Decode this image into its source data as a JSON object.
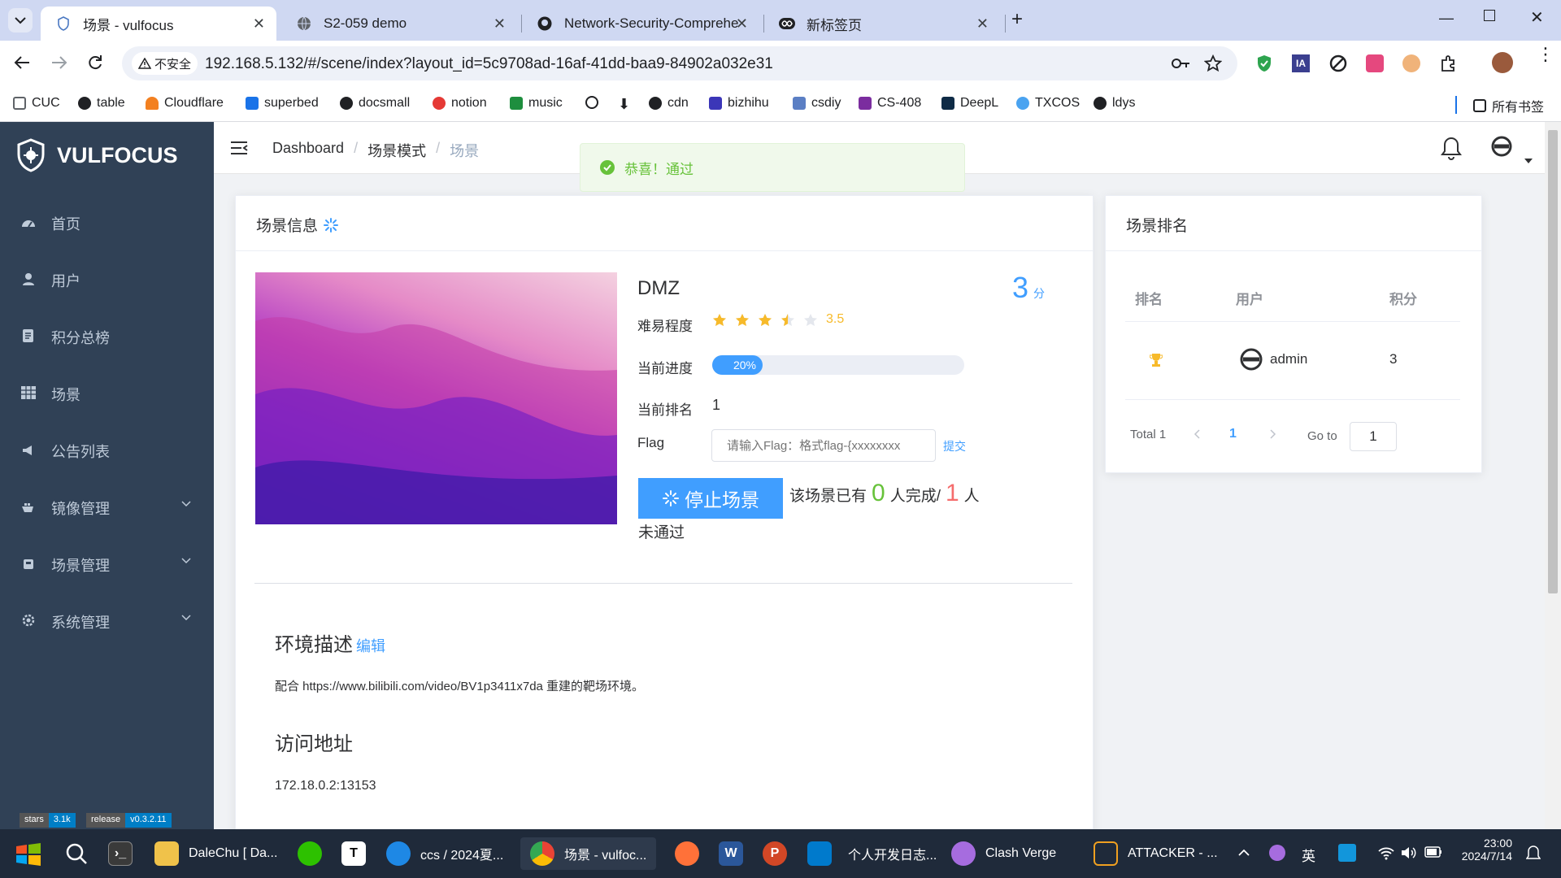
{
  "browser": {
    "tabs": [
      {
        "title": "场景 - vulfocus",
        "active": true
      },
      {
        "title": "S2-059 demo",
        "active": false
      },
      {
        "title": "Network-Security-Comprehe",
        "active": false
      },
      {
        "title": "新标签页",
        "active": false
      }
    ],
    "security_label": "不安全",
    "url": "192.168.5.132/#/scene/index?layout_id=5c9708ad-16af-41dd-baa9-84902a032e31",
    "bookmarks": [
      "CUC",
      "table",
      "Cloudflare",
      "superbed",
      "docsmall",
      "notion",
      "music",
      "cdn",
      "bizhihu",
      "csdiy",
      "CS-408",
      "DeepL",
      "TXCOS",
      "ldys"
    ],
    "all_bookmarks": "所有书签",
    "ext_ia": "IA"
  },
  "sidebar": {
    "logo": "VULFOCUS",
    "items": [
      {
        "label": "首页",
        "icon": "dashboard-icon"
      },
      {
        "label": "用户",
        "icon": "user-icon"
      },
      {
        "label": "积分总榜",
        "icon": "leaderboard-icon"
      },
      {
        "label": "场景",
        "icon": "table-icon"
      },
      {
        "label": "公告列表",
        "icon": "megaphone-icon"
      },
      {
        "label": "镜像管理",
        "icon": "image-icon"
      },
      {
        "label": "场景管理",
        "icon": "scene-icon"
      },
      {
        "label": "系统管理",
        "icon": "settings-icon"
      }
    ],
    "badges": {
      "stars_label": "stars",
      "stars_value": "3.1k",
      "release_label": "release",
      "release_value": "v0.3.2.11"
    }
  },
  "breadcrumb": [
    "Dashboard",
    "场景模式",
    "场景"
  ],
  "toast": "恭喜！通过",
  "scene": {
    "card_title": "场景信息",
    "name": "DMZ",
    "score": "3",
    "score_unit": "分",
    "difficulty_label": "难易程度",
    "difficulty_value": "3.5",
    "rating": 3.5,
    "progress_label": "当前进度",
    "progress_text": "20%",
    "progress": 0.2,
    "rank_label": "当前排名",
    "rank_value": "1",
    "flag_label": "Flag",
    "flag_placeholder": "请输入Flag：格式flag-{xxxxxxxx",
    "submit": "提交",
    "stop_button": "停止场景",
    "status_prefix": "该场景已有",
    "completed_count": "0",
    "status_mid": "人完成/",
    "failed_count": "1",
    "status_suffix_a": "人",
    "status_suffix_b": "未通过",
    "env_title": "环境描述",
    "edit": "编辑",
    "env_desc": "配合 https://www.bilibili.com/video/BV1p3411x7da 重建的靶场环境。",
    "access_title": "访问地址",
    "access_addr": "172.18.0.2:13153"
  },
  "ranking": {
    "title": "场景排名",
    "headers": [
      "排名",
      "用户",
      "积分"
    ],
    "rows": [
      {
        "user": "admin",
        "score": "3"
      }
    ],
    "total": "Total 1",
    "page": "1",
    "goto_label": "Go to",
    "goto_value": "1"
  },
  "taskbar": {
    "apps": [
      {
        "label": "DaleChu [ Da..."
      },
      {
        "label": "ccs / 2024夏..."
      },
      {
        "label": "场景 - vulfoc..."
      },
      {
        "label": "个人开发日志..."
      },
      {
        "label": "Clash Verge"
      },
      {
        "label": "ATTACKER - ..."
      }
    ],
    "ime": "英",
    "time": "23:00",
    "date": "2024/7/14"
  },
  "colors": {
    "primary": "#409eff",
    "sidebar": "#304156",
    "success": "#67c23a",
    "danger": "#f56c6c",
    "star": "#f7ba2a"
  }
}
